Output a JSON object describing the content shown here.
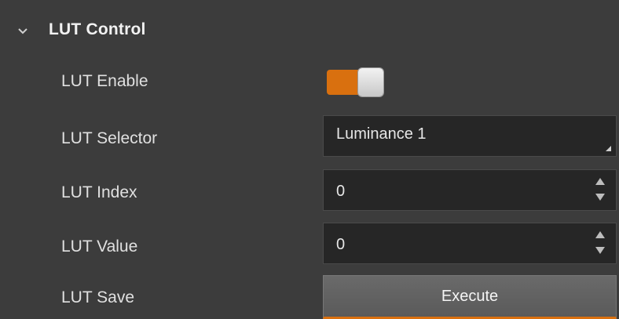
{
  "section": {
    "title": "LUT Control",
    "expanded": true
  },
  "rows": {
    "enable": {
      "label": "LUT Enable",
      "value": true,
      "accent": "#d9700f"
    },
    "selector": {
      "label": "LUT Selector",
      "value": "Luminance 1"
    },
    "index": {
      "label": "LUT Index",
      "value": "0"
    },
    "value": {
      "label": "LUT Value",
      "value": "0"
    },
    "save": {
      "label": "LUT Save",
      "button_label": "Execute"
    }
  },
  "icons": {
    "collapse": "chevron-down-icon",
    "select_corner": "dropdown-corner-icon",
    "spin_up": "spin-up-icon",
    "spin_down": "spin-down-icon"
  }
}
